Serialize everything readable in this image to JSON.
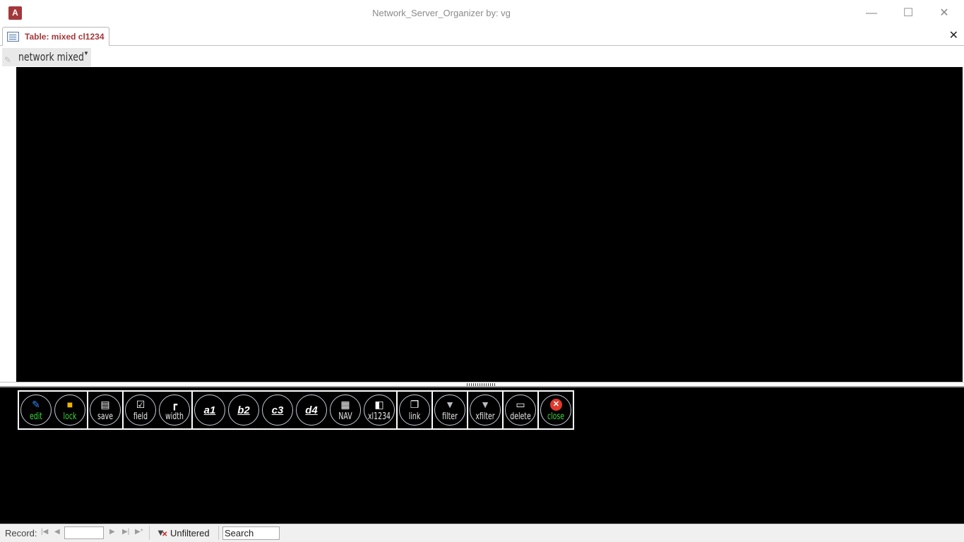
{
  "window": {
    "app_icon": "access-icon",
    "app_icon_text": "A",
    "title": "Network_Server_Organizer by: vg",
    "minimize": "—",
    "maximize": "☐",
    "close": "✕"
  },
  "tab": {
    "label": "Table: mixed cl1234",
    "close": "✕"
  },
  "form_header": {
    "title": "network mixed"
  },
  "toolbar": {
    "groups": [
      [
        {
          "label": "edit",
          "icon": "pencil-icon"
        },
        {
          "label": "lock",
          "icon": "lock-icon"
        }
      ],
      [
        {
          "label": "save",
          "icon": "save-icon"
        }
      ],
      [
        {
          "label": "field",
          "icon": "field-icon"
        },
        {
          "label": "width",
          "icon": "width-icon"
        }
      ],
      [
        {
          "label": "a1"
        },
        {
          "label": "b2"
        },
        {
          "label": "c3"
        },
        {
          "label": "d4"
        },
        {
          "label": "NAV",
          "icon": "nav-icon"
        },
        {
          "label": "xl1234",
          "icon": "export-icon"
        }
      ],
      [
        {
          "label": "link",
          "icon": "link-icon"
        }
      ],
      [
        {
          "label": "filter",
          "icon": "filter-icon"
        }
      ],
      [
        {
          "label": "xfilter",
          "icon": "clear-filter-icon"
        }
      ],
      [
        {
          "label": "delete",
          "icon": "delete-icon"
        }
      ],
      [
        {
          "label": "close",
          "icon": "close-icon"
        }
      ]
    ]
  },
  "status": {
    "record_label": "Record:",
    "record_value": "",
    "filter_state": "Unfiltered",
    "search": "Search"
  },
  "colors": {
    "accent": "#a4373a",
    "canvas": "#000000",
    "label_green": "#3cd63c"
  }
}
